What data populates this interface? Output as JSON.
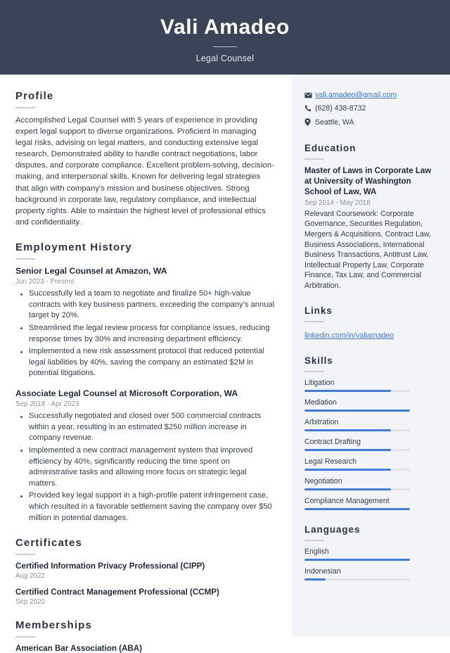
{
  "header": {
    "name": "Vali Amadeo",
    "job_title": "Legal Counsel"
  },
  "colors": {
    "header_background": "#3a4458",
    "sidebar_background": "#f3f4f7",
    "accent_blue": "#3a7bf0",
    "link_blue": "#3f77ef",
    "heading_text": "#2b3445",
    "muted_text": "#8b919c"
  },
  "main": {
    "profile": {
      "heading": "Profile",
      "text": "Accomplished Legal Counsel with 5 years of experience in providing expert legal support to diverse organizations. Proficient in managing legal risks, advising on legal matters, and conducting extensive legal research. Demonstrated ability to handle contract negotiations, labor disputes, and corporate compliance. Excellent problem-solving, decision-making, and interpersonal skills. Known for delivering legal strategies that align with company's mission and business objectives. Strong background in corporate law, regulatory compliance, and intellectual property rights. Able to maintain the highest level of professional ethics and confidentiality."
    },
    "employment": {
      "heading": "Employment History",
      "jobs": [
        {
          "title": "Senior Legal Counsel at Amazon, WA",
          "date": "Jun 2023 - Present",
          "bullets": [
            "Successfully led a team to negotiate and finalize 50+ high-value contracts with key business partners, exceeding the company's annual target by 20%.",
            "Streamlined the legal review process for compliance issues, reducing response times by 30% and increasing department efficiency.",
            "Implemented a new risk assessment protocol that reduced potential legal liabilities by 40%, saving the company an estimated $2M in potential litigations."
          ]
        },
        {
          "title": "Associate Legal Counsel at Microsoft Corporation, WA",
          "date": "Sep 2018 - Apr 2023",
          "bullets": [
            "Successfully negotiated and closed over 500 commercial contracts within a year, resulting in an estimated $250 million increase in company revenue.",
            "Implemented a new contract management system that improved efficiency by 40%, significantly reducing the time spent on administrative tasks and allowing more focus on strategic legal matters.",
            "Provided key legal support in a high-profile patent infringement case, which resulted in a favorable settlement saving the company over $50 million in potential damages."
          ]
        }
      ]
    },
    "certificates": {
      "heading": "Certificates",
      "items": [
        {
          "name": "Certified Information Privacy Professional (CIPP)",
          "date": "Aug 2022"
        },
        {
          "name": "Certified Contract Management Professional (CCMP)",
          "date": "Sep 2020"
        }
      ]
    },
    "memberships": {
      "heading": "Memberships",
      "items": [
        {
          "name": "American Bar Association (ABA)"
        }
      ]
    }
  },
  "sidebar": {
    "contact": [
      {
        "icon": "envelope-icon",
        "text": "vali.amadeo@gmail.com",
        "is_link": true
      },
      {
        "icon": "phone-icon",
        "text": "(628) 438-8732",
        "is_link": false
      },
      {
        "icon": "location-pin-icon",
        "text": "Seattle, WA",
        "is_link": false
      }
    ],
    "education": {
      "heading": "Education",
      "degree": "Master of Laws in Corporate Law at University of Washington School of Law, WA",
      "date": "Sep 2014 - May 2018",
      "description": "Relevant Coursework: Corporate Governance, Securities Regulation, Mergers & Acquisitions, Contract Law, Business Associations, International Business Transactions, Antitrust Law, Intellectual Property Law, Corporate Finance, Tax Law, and Commercial Arbitration."
    },
    "links": {
      "heading": "Links",
      "items": [
        {
          "label": "linkedin.com/in/valiamadeo"
        }
      ]
    },
    "skills": {
      "heading": "Skills",
      "items": [
        {
          "label": "Litigation",
          "level": 82
        },
        {
          "label": "Mediation",
          "level": 100
        },
        {
          "label": "Arbitration",
          "level": 82
        },
        {
          "label": "Contract Drafting",
          "level": 82
        },
        {
          "label": "Legal Research",
          "level": 82
        },
        {
          "label": "Negotiation",
          "level": 82
        },
        {
          "label": "Compliance Management",
          "level": 100
        }
      ]
    },
    "languages": {
      "heading": "Languages",
      "items": [
        {
          "label": "English",
          "level": 100
        },
        {
          "label": "Indonesian",
          "level": 20
        }
      ]
    }
  }
}
